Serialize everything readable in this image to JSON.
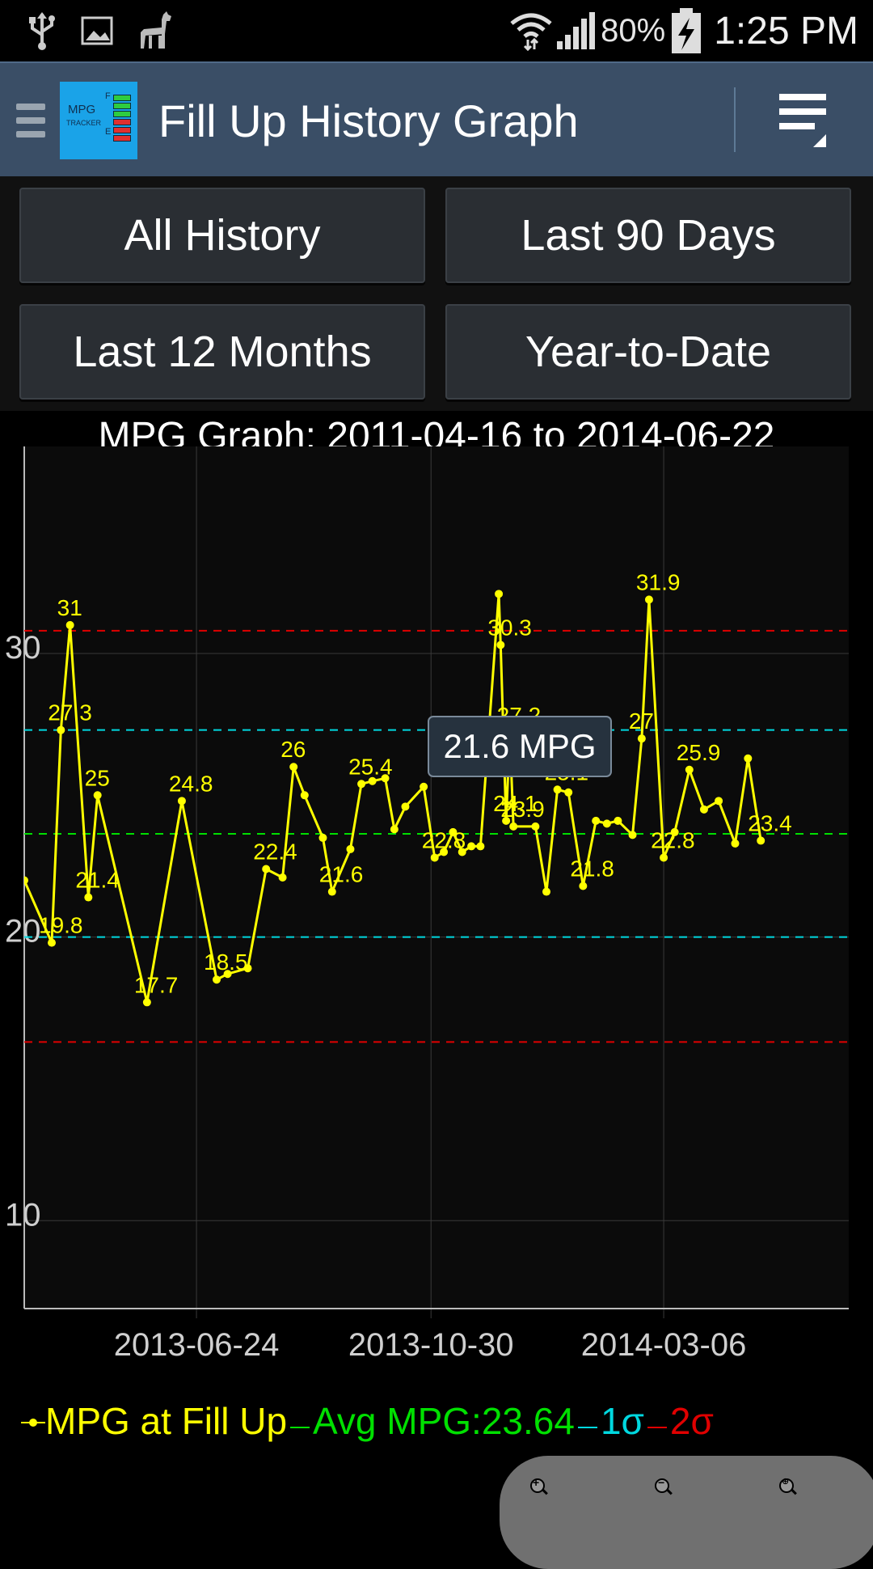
{
  "status_bar": {
    "battery": "80%",
    "time": "1:25 PM"
  },
  "action_bar": {
    "title": "Fill Up History Graph",
    "logo": {
      "line1": "MPG",
      "line2": "TRACKER",
      "fuel_full": "F",
      "fuel_empty": "E"
    }
  },
  "buttons": {
    "all_history": "All History",
    "last_90_days": "Last 90 Days",
    "last_12_months": "Last 12 Months",
    "year_to_date": "Year-to-Date"
  },
  "graph": {
    "title": "MPG Graph: 2011-04-16 to 2014-06-22",
    "tooltip": "21.6 MPG"
  },
  "legend": {
    "series": "MPG at Fill Up",
    "avg": "Avg MPG:23.64",
    "sigma1": "1σ",
    "sigma2": "2σ"
  },
  "colors": {
    "series": "#ffff00",
    "avg": "#00e000",
    "sigma1": "#00d8e0",
    "sigma2": "#e00000",
    "action_bar": "#3a4e66"
  },
  "chart_data": {
    "type": "line",
    "title": "MPG Graph: 2011-04-16 to 2014-06-22",
    "xlabel": "",
    "ylabel": "",
    "yticks": [
      10,
      20,
      30
    ],
    "xticks": [
      "2013-06-24",
      "2013-10-30",
      "2014-03-06"
    ],
    "ylim": [
      6.9,
      37.3
    ],
    "xlim": [
      "2013-03-22",
      "2014-06-15"
    ],
    "grid": true,
    "reference_lines": [
      {
        "name": "Avg MPG",
        "value": 23.64,
        "color": "#00e000"
      },
      {
        "name": "+1σ",
        "value": 27.3,
        "color": "#00d8e0"
      },
      {
        "name": "-1σ",
        "value": 20.0,
        "color": "#00d8e0"
      },
      {
        "name": "+2σ",
        "value": 30.8,
        "color": "#e00000"
      },
      {
        "name": "-2σ",
        "value": 16.3,
        "color": "#e00000"
      }
    ],
    "series": [
      {
        "name": "MPG at Fill Up",
        "color": "#ffff00",
        "points": [
          [
            "2013-03-22",
            22.0,
            null
          ],
          [
            "2013-04-06",
            19.8,
            "19.8"
          ],
          [
            "2013-04-11",
            27.3,
            "27.3"
          ],
          [
            "2013-04-16",
            31.0,
            "31"
          ],
          [
            "2013-04-26",
            21.4,
            "21.4"
          ],
          [
            "2013-05-01",
            25.0,
            "25"
          ],
          [
            "2013-05-28",
            17.7,
            "17.7"
          ],
          [
            "2013-06-16",
            24.8,
            "24.8"
          ],
          [
            "2013-07-05",
            18.5,
            "18.5"
          ],
          [
            "2013-07-11",
            18.7,
            null
          ],
          [
            "2013-07-22",
            18.9,
            null
          ],
          [
            "2013-08-01",
            22.4,
            "22.4"
          ],
          [
            "2013-08-10",
            22.1,
            null
          ],
          [
            "2013-08-16",
            26.0,
            "26"
          ],
          [
            "2013-08-22",
            25.0,
            null
          ],
          [
            "2013-09-01",
            23.5,
            null
          ],
          [
            "2013-09-06",
            21.6,
            "21.6"
          ],
          [
            "2013-09-16",
            23.1,
            null
          ],
          [
            "2013-09-22",
            25.4,
            "25.4"
          ],
          [
            "2013-09-28",
            25.5,
            null
          ],
          [
            "2013-10-05",
            25.6,
            null
          ],
          [
            "2013-10-10",
            23.8,
            null
          ],
          [
            "2013-10-16",
            24.6,
            null
          ],
          [
            "2013-10-26",
            25.3,
            null
          ],
          [
            "2013-11-01",
            22.8,
            "22.8"
          ],
          [
            "2013-11-06",
            23.0,
            null
          ],
          [
            "2013-11-11",
            23.7,
            null
          ],
          [
            "2013-11-16",
            23.0,
            null
          ],
          [
            "2013-11-21",
            23.2,
            null
          ],
          [
            "2013-11-26",
            23.2,
            null
          ],
          [
            "2013-12-06",
            32.1,
            null
          ],
          [
            "2013-12-07",
            30.3,
            "30.3"
          ],
          [
            "2013-12-10",
            24.1,
            "24.1"
          ],
          [
            "2013-12-12",
            27.2,
            "27.2"
          ],
          [
            "2013-12-14",
            23.9,
            "23.9"
          ],
          [
            "2013-12-26",
            23.9,
            null
          ],
          [
            "2014-01-01",
            21.6,
            "21.6 MPG"
          ],
          [
            "2014-01-07",
            25.2,
            "25.1"
          ],
          [
            "2014-01-13",
            25.1,
            null
          ],
          [
            "2014-01-21",
            21.8,
            "21.8"
          ],
          [
            "2014-01-28",
            24.1,
            null
          ],
          [
            "2014-02-03",
            24.0,
            null
          ],
          [
            "2014-02-09",
            24.1,
            null
          ],
          [
            "2014-02-17",
            23.6,
            null
          ],
          [
            "2014-02-22",
            27.0,
            "27"
          ],
          [
            "2014-02-26",
            31.9,
            "31.9"
          ],
          [
            "2014-03-06",
            22.8,
            "22.8"
          ],
          [
            "2014-03-12",
            23.7,
            null
          ],
          [
            "2014-03-20",
            25.9,
            "25.9"
          ],
          [
            "2014-03-28",
            24.5,
            null
          ],
          [
            "2014-04-05",
            24.8,
            null
          ],
          [
            "2014-04-14",
            23.3,
            null
          ],
          [
            "2014-04-21",
            26.3,
            null
          ],
          [
            "2014-04-28",
            23.4,
            "23.4"
          ]
        ]
      }
    ]
  }
}
